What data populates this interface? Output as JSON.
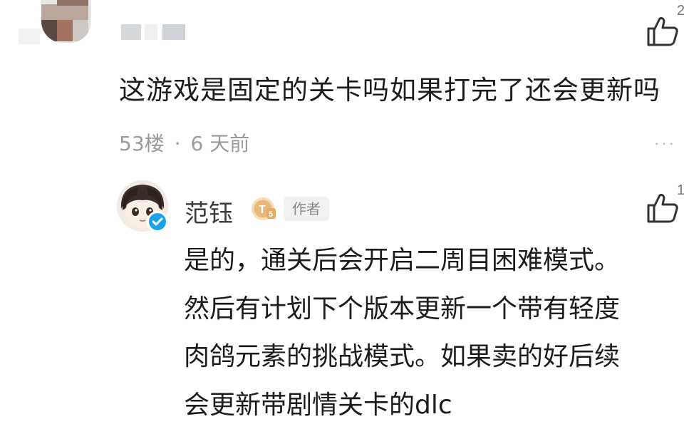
{
  "comment": {
    "text": "这游戏是固定的关卡吗如果打完了还会更新吗",
    "floor": "53楼",
    "separator": "·",
    "time": "6 天前",
    "like_count": "2",
    "like_icon": "thumbs-up-icon",
    "more_icon": "more-horizontal-icon",
    "more_text": "···"
  },
  "reply": {
    "author": "范钰",
    "level_badge_text": "T5",
    "level_badge_icon": "level-badge-icon",
    "author_tag": "作者",
    "verified_icon": "verified-check-icon",
    "like_count": "1",
    "like_icon": "thumbs-up-icon",
    "lines": [
      "是的，通关后会开启二周目困难模式。",
      "然后有计划下个版本更新一个带有轻度",
      "肉鸽元素的挑战模式。如果卖的好后续",
      "会更新带剧情关卡的dlc"
    ]
  },
  "colors": {
    "badge_gold": "#e9b97a",
    "verify_blue": "#1aa3e8",
    "meta_gray": "#9a9a9a"
  }
}
